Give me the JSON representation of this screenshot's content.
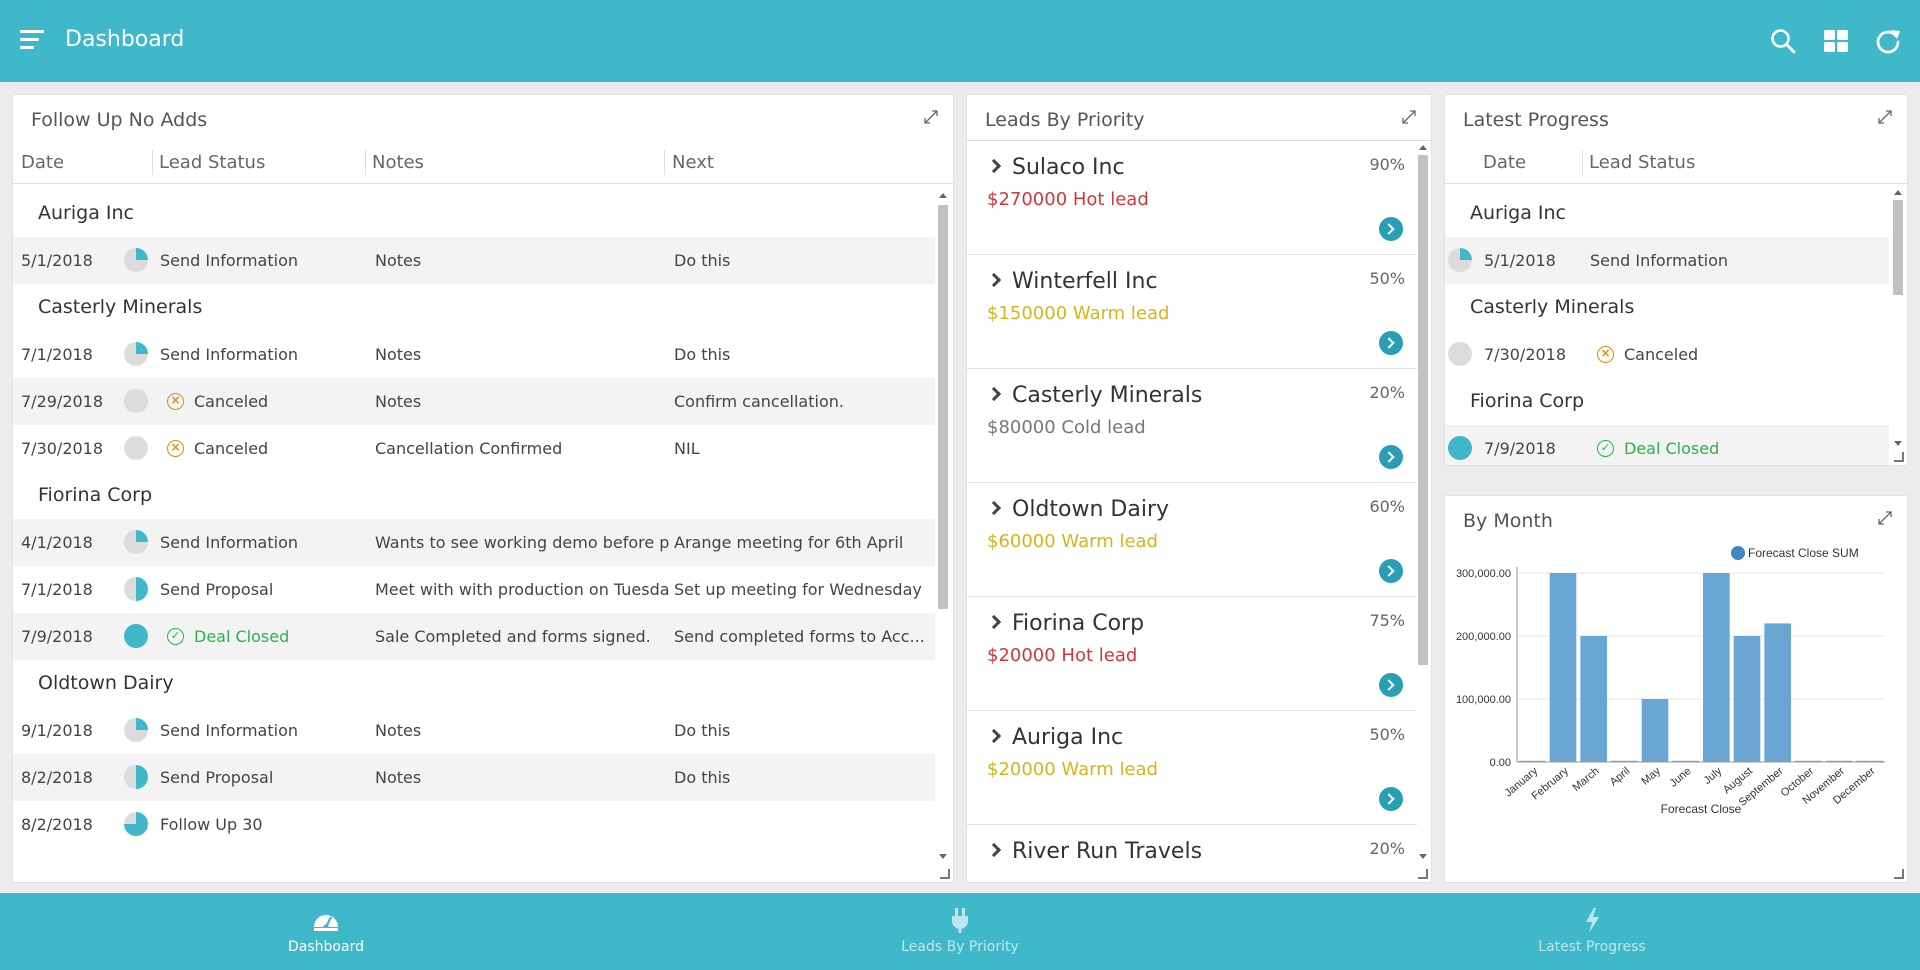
{
  "header": {
    "title": "Dashboard",
    "icons": [
      "menu-icon",
      "search-icon",
      "grid-icon",
      "refresh-icon"
    ]
  },
  "colors": {
    "brand": "#3fb8c9",
    "hot": "#d1373a",
    "warm": "#d7b31c",
    "cold": "#777777",
    "closed": "#28b34a",
    "canceled": "#e08a17",
    "progress": "#3fb8c9"
  },
  "follow_up": {
    "title": "Follow Up No Adds",
    "columns": [
      "Date",
      "Lead Status",
      "Notes",
      "Next"
    ],
    "groups": [
      {
        "name": "Auriga Inc",
        "rows": [
          {
            "date": "5/1/2018",
            "status": "Send Information",
            "progress": 0.25,
            "kind": "info",
            "notes": "Notes",
            "next": "Do this"
          }
        ]
      },
      {
        "name": "Casterly Minerals",
        "rows": [
          {
            "date": "7/1/2018",
            "status": "Send Information",
            "progress": 0.25,
            "kind": "info",
            "notes": "Notes",
            "next": "Do this"
          },
          {
            "date": "7/29/2018",
            "status": "Canceled",
            "progress": 0,
            "kind": "canceled",
            "notes": "Notes",
            "next": "Confirm cancellation."
          },
          {
            "date": "7/30/2018",
            "status": "Canceled",
            "progress": 0,
            "kind": "canceled",
            "notes": "Cancellation Confirmed",
            "next": "NIL"
          }
        ]
      },
      {
        "name": "Fiorina Corp",
        "rows": [
          {
            "date": "4/1/2018",
            "status": "Send Information",
            "progress": 0.25,
            "kind": "info",
            "notes": "Wants to see working demo before pur",
            "next": "Arange meeting for 6th April"
          },
          {
            "date": "7/1/2018",
            "status": "Send Proposal",
            "progress": 0.5,
            "kind": "info",
            "notes": "Meet with with production on Tuesday",
            "next": "Set up meeting for Wednesday"
          },
          {
            "date": "7/9/2018",
            "status": "Deal Closed",
            "progress": 1,
            "kind": "closed",
            "notes": "Sale Completed and forms signed.",
            "next": "Send completed forms to Acc..."
          }
        ]
      },
      {
        "name": "Oldtown Dairy",
        "rows": [
          {
            "date": "9/1/2018",
            "status": "Send Information",
            "progress": 0.25,
            "kind": "info",
            "notes": "Notes",
            "next": "Do this"
          },
          {
            "date": "8/2/2018",
            "status": "Send Proposal",
            "progress": 0.5,
            "kind": "info",
            "notes": "Notes",
            "next": "Do this"
          },
          {
            "date": "8/2/2018",
            "status": "Follow Up 30",
            "progress": 0.75,
            "kind": "info",
            "notes": "",
            "next": ""
          }
        ]
      }
    ]
  },
  "leads": {
    "title": "Leads By Priority",
    "items": [
      {
        "name": "Sulaco Inc",
        "percent": "90%",
        "value": "$270000 Hot lead",
        "temp": "hot"
      },
      {
        "name": "Winterfell Inc",
        "percent": "50%",
        "value": "$150000 Warm lead",
        "temp": "warm"
      },
      {
        "name": "Casterly Minerals",
        "percent": "20%",
        "value": "$80000 Cold lead",
        "temp": "cold"
      },
      {
        "name": "Oldtown Dairy",
        "percent": "60%",
        "value": "$60000 Warm lead",
        "temp": "warm"
      },
      {
        "name": "Fiorina Corp",
        "percent": "75%",
        "value": "$20000 Hot lead",
        "temp": "hot"
      },
      {
        "name": "Auriga Inc",
        "percent": "50%",
        "value": "$20000 Warm lead",
        "temp": "warm"
      },
      {
        "name": "River Run Travels",
        "percent": "20%",
        "value": "",
        "temp": "cold"
      }
    ]
  },
  "latest": {
    "title": "Latest Progress",
    "columns": [
      "Date",
      "Lead Status"
    ],
    "groups": [
      {
        "name": "Auriga Inc",
        "rows": [
          {
            "date": "5/1/2018",
            "status": "Send Information",
            "progress": 0.25,
            "kind": "info"
          }
        ]
      },
      {
        "name": "Casterly Minerals",
        "rows": [
          {
            "date": "7/30/2018",
            "status": "Canceled",
            "progress": 0,
            "kind": "canceled"
          }
        ]
      },
      {
        "name": "Fiorina Corp",
        "rows": [
          {
            "date": "7/9/2018",
            "status": "Deal Closed",
            "progress": 1,
            "kind": "closed"
          }
        ]
      }
    ]
  },
  "by_month": {
    "title": "By Month"
  },
  "chart_data": {
    "type": "bar",
    "categories": [
      "January",
      "February",
      "March",
      "April",
      "May",
      "June",
      "July",
      "August",
      "September",
      "October",
      "November",
      "December"
    ],
    "series": [
      {
        "name": "Forecast Close SUM",
        "values": [
          0,
          300000,
          200000,
          0,
          100000,
          0,
          300000,
          200000,
          220000,
          0,
          0,
          0
        ],
        "color": "#6aa6d3"
      }
    ],
    "ylim": [
      0,
      300000
    ],
    "yticks": [
      "0.00",
      "100,000.00",
      "200,000.00",
      "300,000.00"
    ],
    "xlabel": "Forecast Close",
    "legend": "top-right",
    "grid": true
  },
  "bottom_nav": [
    {
      "label": "Dashboard",
      "icon": "speedometer-icon",
      "active": true
    },
    {
      "label": "Leads By Priority",
      "icon": "plug-icon",
      "active": false
    },
    {
      "label": "Latest Progress",
      "icon": "lightning-icon",
      "active": false
    }
  ]
}
